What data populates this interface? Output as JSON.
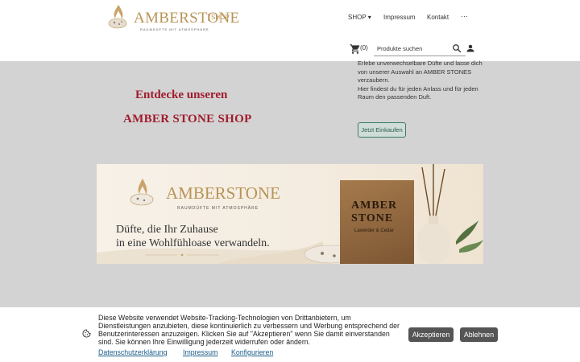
{
  "header": {
    "logo": {
      "brand": "AMBERSTONE",
      "shop_tag": "SHOP",
      "tagline": "RAUMDÜFTE MIT ATMOSPHÄRE"
    },
    "nav": {
      "shop": "SHOP ▾",
      "impressum": "Impressum",
      "kontakt": "Kontakt",
      "more": "···"
    },
    "cart": {
      "icon": "cart-icon",
      "count": "(0)"
    },
    "search": {
      "placeholder": "Produkte suchen",
      "icon": "search-icon"
    },
    "user": {
      "icon": "user-icon"
    }
  },
  "hero": {
    "title_line1": "Entdecke unseren",
    "title_line2": "AMBER STONE SHOP",
    "paragraph1": "Erlebe unverwechselbare  Düfte und lasse dich von unserer Auswahl an AMBER STONES verzaubern.",
    "paragraph2": "Hier findest du für jeden Anlass und für jeden Raum den passenden  Duft.",
    "button_label": "Jetzt Einkaufen",
    "title_color": "#a01c2e",
    "background_color": "#d3d3d3"
  },
  "banner": {
    "brand": "AMBERSTONE",
    "tagline": "RAUMDÜFTE MIT ATMOSPHÄRE",
    "slogan_line1": "Düfte, die Ihr Zuhause",
    "slogan_line2": "in eine Wohlfühloase verwandeln.",
    "box_line1": "AMBER",
    "box_line2": "STONE",
    "box_line3": "Lavender & Cedar"
  },
  "cookie": {
    "icon": "cookie-icon",
    "text": "Diese Website verwendet Website-Tracking-Technologien von Drittanbietern, um Dienstleistungen anzubieten, diese kontinuierlich zu verbessern und Werbung entsprechend der Benutzerinteressen anzuzeigen. Klicken Sie auf \"Akzeptieren\" wenn Sie damit einverstanden sind. Sie können Ihre Einwilligung jederzeit widerrufen oder ändern.",
    "links": {
      "privacy": "Datenschutzerklärung",
      "impressum": "Impressum",
      "configure": "Konfigurieren"
    },
    "accept": "Akzeptieren",
    "reject": "Ablehnen"
  }
}
